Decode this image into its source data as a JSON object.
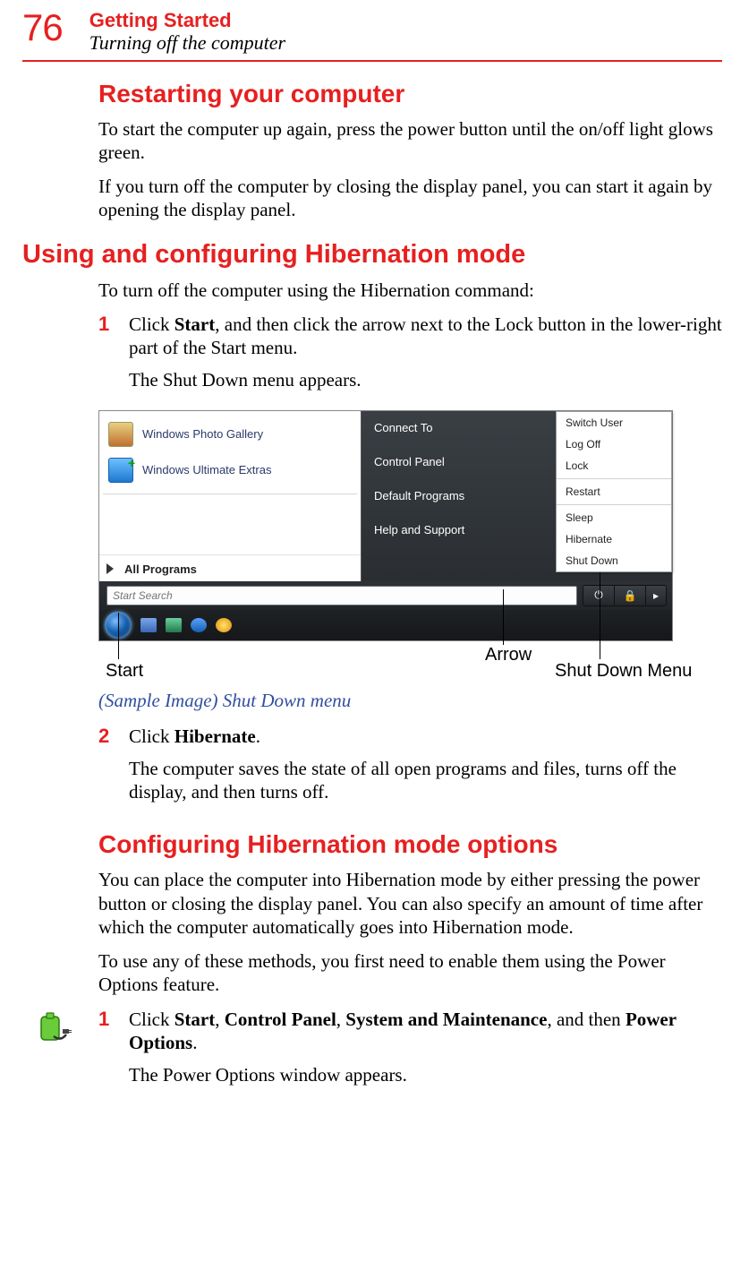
{
  "header": {
    "page_number": "76",
    "chapter": "Getting Started",
    "subtitle": "Turning off the computer"
  },
  "section1": {
    "title": "Restarting your computer",
    "p1": "To start the computer up again, press the power button until the on/off light glows green.",
    "p2": "If you turn off the computer by closing the display panel, you can start it again by opening the display panel."
  },
  "section2": {
    "title": "Using and configuring Hibernation mode",
    "intro": "To turn off the computer using the Hibernation command:",
    "step1_num": "1",
    "step1_a": "Click ",
    "step1_b": "Start",
    "step1_c": ", and then click the arrow next to the Lock button in the lower-right part of the Start menu.",
    "step1_p2": "The Shut Down menu appears.",
    "caption": "(Sample Image) Shut Down menu",
    "step2_num": "2",
    "step2_a": "Click ",
    "step2_b": "Hibernate",
    "step2_c": ".",
    "step2_p2": "The computer saves the state of all open programs and files, turns off the display, and then turns off."
  },
  "screenshot": {
    "left_items": [
      "Windows Photo Gallery",
      "Windows Ultimate Extras"
    ],
    "all_programs": "All Programs",
    "right_items": [
      "Connect To",
      "Control Panel",
      "Default Programs",
      "Help and Support"
    ],
    "menu_items_top": [
      "Switch User",
      "Log Off",
      "Lock"
    ],
    "menu_items_mid": [
      "Restart"
    ],
    "menu_items_bot": [
      "Sleep",
      "Hibernate",
      "Shut Down"
    ],
    "search_placeholder": "Start Search",
    "power_glyph": "⏻",
    "lock_glyph": "🔒",
    "arrow_glyph": "▸"
  },
  "callouts": {
    "start": "Start",
    "arrow": "Arrow",
    "menu": "Shut Down Menu"
  },
  "section3": {
    "title": "Configuring Hibernation mode options",
    "p1": "You can place the computer into Hibernation mode by either pressing the power button or closing the display panel. You can also specify an amount of time after which the computer automatically goes into Hibernation mode.",
    "p2": "To use any of these methods, you first need to enable them using the Power Options feature.",
    "step1_num": "1",
    "s1_a": "Click ",
    "s1_b": "Start",
    "s1_c": ", ",
    "s1_d": "Control Panel",
    "s1_e": ", ",
    "s1_f": "System and Maintenance",
    "s1_g": ", and then ",
    "s1_h": "Power Options",
    "s1_i": ".",
    "s1_p2": "The Power Options window appears."
  }
}
